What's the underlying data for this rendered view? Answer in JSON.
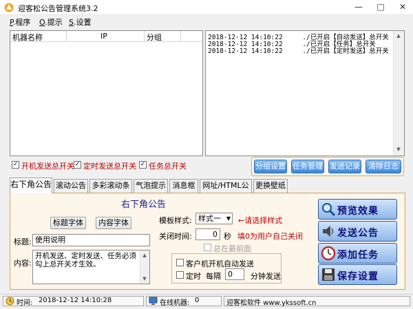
{
  "window": {
    "title": "迎客松公告管理系统3.2",
    "controls": [
      "—",
      "□",
      "✕"
    ]
  },
  "menu": [
    {
      "key": "P",
      "label": ".程序"
    },
    {
      "key": "O",
      "label": ".提示"
    },
    {
      "key": "S",
      "label": ".设置"
    }
  ],
  "machines": {
    "columns": [
      "机器名称",
      "IP",
      "分组"
    ],
    "rows": []
  },
  "log": [
    "2018-12-12 14:10:22     ./已开启【自动发送】总开关",
    "2018-12-12 14:10:22     ./已开启【任务】总开关",
    "2018-12-12 14:10:22     ./已开启【定时发送】总开关"
  ],
  "switches": [
    {
      "label": "开机发送总开关",
      "checked": true
    },
    {
      "label": "定时发送总开关",
      "checked": true
    },
    {
      "label": "任务总开关",
      "checked": true
    }
  ],
  "action_buttons": [
    "分组设置",
    "任务管理",
    "发送记录",
    "清除日志"
  ],
  "tabs": [
    "右下角公告",
    "滚动公告",
    "多彩滚动条",
    "气泡提示",
    "消息框",
    "网址/HTML公告",
    "更换壁纸"
  ],
  "active_tab": 0,
  "panel": {
    "heading": "右下角公告",
    "title_font_button": "标题字体",
    "content_font_button": "内容字体",
    "title_label": "标题:",
    "title_value": "使用说明",
    "content_label": "内容:",
    "content_value": "开机发送、定时发送、任务必须勾上总开关才生效。",
    "template_label": "模板样式:",
    "template_value": "样式一",
    "template_hint": "←请选择样式",
    "close_label": "关闭时间:",
    "close_value": "0",
    "close_unit": "秒",
    "close_hint": "填0为用户自己关闭",
    "front_label": "总在最前面",
    "auto_send_label": "客户机开机自动发送",
    "timer_label": "定时",
    "interval_label": "每隔",
    "interval_value": "0",
    "interval_unit": "分钟发送"
  },
  "side_buttons": [
    {
      "label": "预览效果",
      "icon": "magnifier-icon"
    },
    {
      "label": "发送公告",
      "icon": "speaker-icon"
    },
    {
      "label": "添加任务",
      "icon": "clock-icon"
    },
    {
      "label": "保存设置",
      "icon": "floppy-icon"
    }
  ],
  "status": {
    "time_label": "时间:",
    "time_value": "2018-12-12 14:10:28",
    "online_label": "在线机器:",
    "online_value": "0",
    "company": "迎客松软件 www.ykssoft.cn"
  },
  "colors": {
    "accent_orange": "#e9a83c",
    "button_blue": "#3d87d8",
    "red_text": "#c00000",
    "hint_red": "#c00000"
  }
}
